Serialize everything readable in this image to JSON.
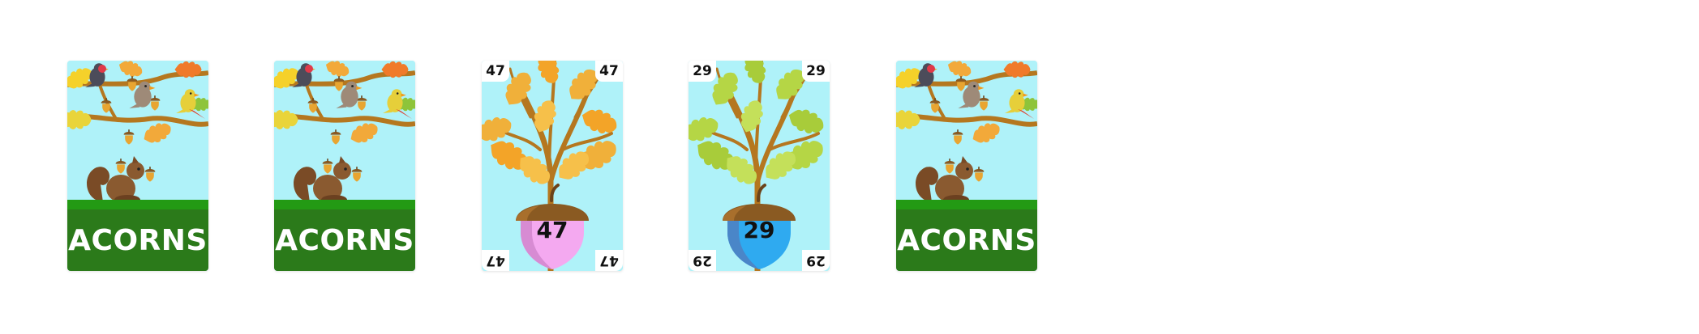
{
  "cards": [
    {
      "kind": "back",
      "title": "ACORNS"
    },
    {
      "kind": "back",
      "title": "ACORNS"
    },
    {
      "kind": "value",
      "value": "47",
      "acorn_color": "#f4a9f0",
      "leaf_color": "#f0b03a"
    },
    {
      "kind": "value",
      "value": "29",
      "acorn_color": "#2faaf0",
      "leaf_color": "#b5d645"
    },
    {
      "kind": "back",
      "title": "ACORNS"
    }
  ],
  "colors": {
    "sky": "#aff2f9",
    "banner": "#2b7a1a",
    "grass": "#239a14",
    "branch": "#b5771f"
  },
  "icons": [
    "bird-icon",
    "squirrel-icon",
    "acorn-icon",
    "oak-leaf-icon"
  ]
}
